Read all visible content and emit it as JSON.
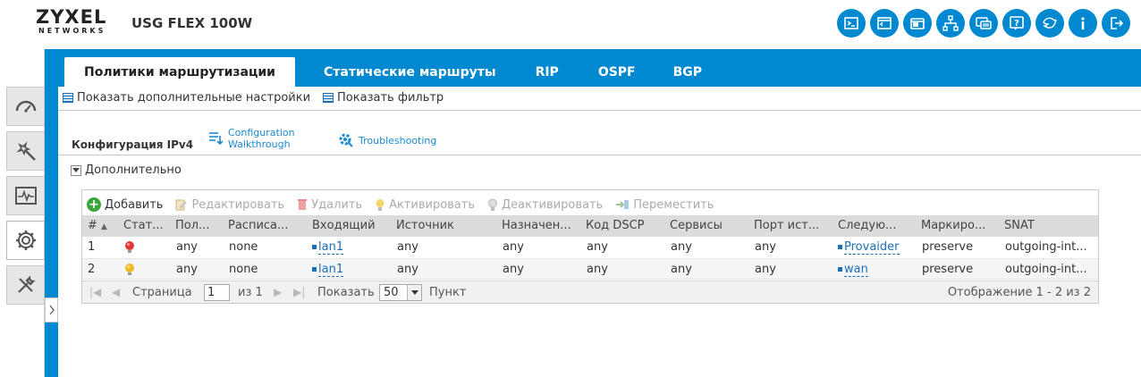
{
  "header": {
    "logo_main": "ZYXEL",
    "logo_sub": "NETWORKS",
    "model": "USG FLEX 100W",
    "icons": [
      "console-icon",
      "cli-icon",
      "window-icon",
      "sitemap-icon",
      "chat-icon",
      "help-icon",
      "logout-bird-icon",
      "info-icon",
      "exit-icon"
    ]
  },
  "colors": {
    "brand": "#0089d0",
    "add": "#3aa63a",
    "link": "#1a6fb8"
  },
  "tabs": [
    {
      "label": "Политики маршрутизации",
      "active": true
    },
    {
      "label": "Статические маршруты",
      "active": false
    },
    {
      "label": "RIP",
      "active": false
    },
    {
      "label": "OSPF",
      "active": false
    },
    {
      "label": "BGP",
      "active": false
    }
  ],
  "subtoolbar": {
    "advanced_settings": "Показать дополнительные настройки",
    "show_filter": "Показать фильтр"
  },
  "section": {
    "title": "Конфигурация IPv4",
    "walkthrough_line1": "Configuration",
    "walkthrough_line2": "Walkthrough",
    "troubleshooting": "Troubleshooting",
    "advanced": "Дополнительно"
  },
  "actions": {
    "add": "Добавить",
    "edit": "Редактировать",
    "delete": "Удалить",
    "activate": "Активировать",
    "deactivate": "Деактивировать",
    "move": "Переместить"
  },
  "table": {
    "headers": [
      "#",
      "Стат...",
      "Пол...",
      "Расписа...",
      "Входящий",
      "Источник",
      "Назначен...",
      "Код DSCP",
      "Сервисы",
      "Порт ист...",
      "Следую...",
      "Маркиро...",
      "SNAT"
    ],
    "rows": [
      {
        "num": "1",
        "status": "red",
        "user": "any",
        "schedule": "none",
        "incoming": "lan1",
        "source": "any",
        "dest": "any",
        "dscp": "any",
        "service": "any",
        "src_port": "any",
        "next_hop": "Provaider",
        "marking": "preserve",
        "snat": "outgoing-int..."
      },
      {
        "num": "2",
        "status": "yellow",
        "user": "any",
        "schedule": "none",
        "incoming": "lan1",
        "source": "any",
        "dest": "any",
        "dscp": "any",
        "service": "any",
        "src_port": "any",
        "next_hop": "wan",
        "marking": "preserve",
        "snat": "outgoing-int..."
      }
    ]
  },
  "pager": {
    "page_label": "Страница",
    "page_value": "1",
    "of_label": "из 1",
    "show_label": "Показать",
    "per_page": "50",
    "items_label": "Пункт",
    "display_text": "Отображение 1 - 2 из 2"
  }
}
